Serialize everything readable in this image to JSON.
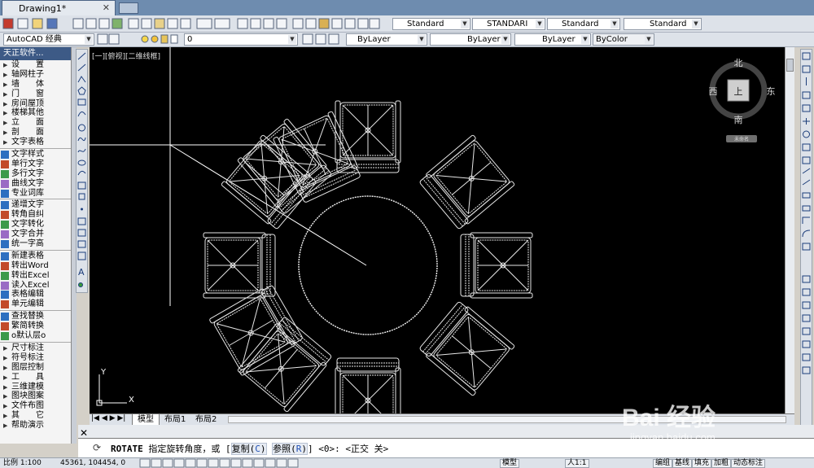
{
  "app": {
    "doc_tab": "Drawing1*",
    "close_glyph": "✕"
  },
  "toolbar1": {
    "text_style": "Standard",
    "dim_style": "STANDARI",
    "table_style": "Standard",
    "mleader_style": "Standard"
  },
  "toolbar2": {
    "workspace": "AutoCAD 经典",
    "layer": "0",
    "color": "ByLayer",
    "linetype": "ByLayer",
    "lineweight": "ByLayer",
    "plotstyle": "ByColor"
  },
  "sidemenu": {
    "header": "天正软件...",
    "groups": [
      [
        "设　　置",
        "轴网柱子",
        "墙　　体",
        "门　　窗",
        "房间屋顶",
        "楼梯其他",
        "立　　面",
        "剖　　面",
        "文字表格"
      ],
      [
        "文字样式",
        "单行文字",
        "多行文字",
        "曲线文字",
        "专业词库"
      ],
      [
        "递增文字",
        "转角自纠",
        "文字转化",
        "文字合并",
        "统一字高"
      ],
      [
        "新建表格",
        "转出Word",
        "转出Excel",
        "读入Excel",
        "表格编辑",
        "单元编辑"
      ],
      [
        "查找替换",
        "繁简转换",
        "o默认层o"
      ],
      [
        "尺寸标注",
        "符号标注",
        "图层控制",
        "工　　具",
        "三维建模",
        "图块图案",
        "文件布图",
        "其　　它",
        "帮助演示"
      ]
    ]
  },
  "viewport": {
    "label": "[一][俯视][二维线框]",
    "viewcube": {
      "north": "北",
      "south": "南",
      "east": "东",
      "west": "西",
      "top": "上",
      "wcs": "未命名"
    },
    "ucs": {
      "x": "X",
      "y": "Y"
    }
  },
  "layout_tabs": [
    "模型",
    "布局1",
    "布局2"
  ],
  "command": {
    "name": "ROTATE",
    "prompt": "指定旋转角度，或",
    "opt1_label": "复制(",
    "opt1_key": "C",
    "opt2_label": "参照(",
    "opt2_key": "R",
    "close": ")",
    "tail": "] <0>:  <正交 关>"
  },
  "status": {
    "scale": "比例 1:100",
    "coords": "45361, 104454, 0",
    "right_items": [
      "模型",
      "人1:1",
      "编组",
      "基线",
      "填充",
      "加粗",
      "动态标注"
    ]
  },
  "watermark": {
    "brand": "Bai 经验",
    "url": "jingyan.baidu.com"
  },
  "colors": {
    "accent": "#3d5a86",
    "canvas": "#000000",
    "lines": "#ffffff",
    "tab": "#6e8caf"
  }
}
